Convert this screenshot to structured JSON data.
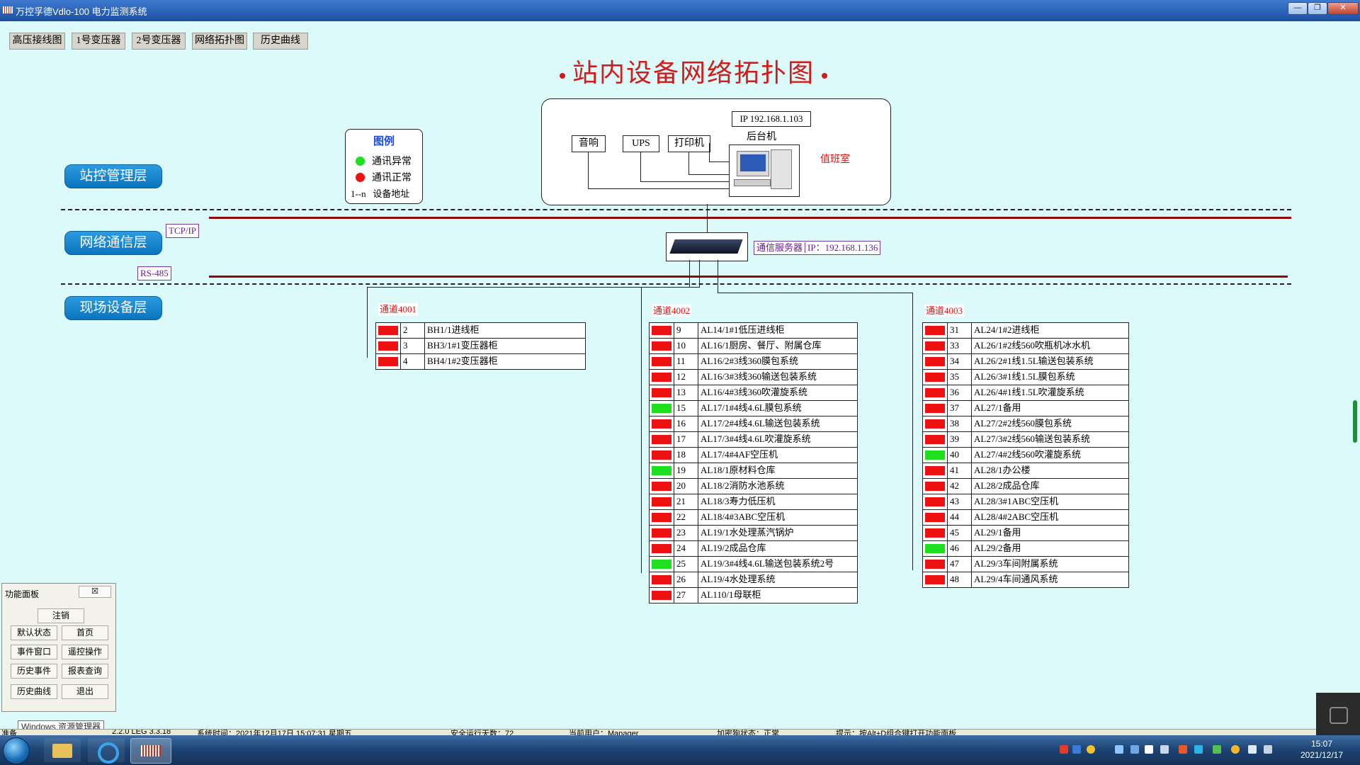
{
  "window": {
    "title": "万控孚德Vdlo-100 电力监测系统"
  },
  "tabs": [
    "高压接线图",
    "1号变压器",
    "2号变压器",
    "网络拓扑图",
    "历史曲线"
  ],
  "page_title": "站内设备网络拓扑图",
  "layers": [
    "站控管理层",
    "网络通信层",
    "现场设备层"
  ],
  "protocols": {
    "tcp": "TCP/IP",
    "rs485": "RS-485"
  },
  "legend": {
    "title": "图例",
    "items": [
      {
        "label": "通讯异常",
        "color": "#1ee01e"
      },
      {
        "label": "通讯正常",
        "color": "#ee1111"
      }
    ],
    "address_key": "1--n",
    "address_label": "设备地址"
  },
  "station": {
    "ip": "IP 192.168.1.103",
    "host": "后台机",
    "room": "值班室",
    "devices": [
      "音响",
      "UPS",
      "打印机"
    ]
  },
  "server": {
    "label": "通信服务器",
    "ip": "IP：192.168.1.136"
  },
  "colors": {
    "ok": "#1ee01e",
    "alarm": "#ee1111",
    "bus": "#8b0a0a"
  },
  "channels": [
    {
      "name": "通道4001",
      "rows": [
        {
          "status": "red",
          "addr": "2",
          "name": "BH1/1进线柜"
        },
        {
          "status": "red",
          "addr": "3",
          "name": "BH3/1#1变压器柜"
        },
        {
          "status": "red",
          "addr": "4",
          "name": "BH4/1#2变压器柜"
        }
      ]
    },
    {
      "name": "通道4002",
      "rows": [
        {
          "status": "red",
          "addr": "9",
          "name": "AL14/1#1低压进线柜"
        },
        {
          "status": "red",
          "addr": "10",
          "name": "AL16/1厨房、餐厅、附属仓库"
        },
        {
          "status": "red",
          "addr": "11",
          "name": "AL16/2#3线360膜包系统"
        },
        {
          "status": "red",
          "addr": "12",
          "name": "AL16/3#3线360输送包装系统"
        },
        {
          "status": "red",
          "addr": "13",
          "name": "AL16/4#3线360吹灌旋系统"
        },
        {
          "status": "green",
          "addr": "15",
          "name": "AL17/1#4线4.6L膜包系统"
        },
        {
          "status": "red",
          "addr": "16",
          "name": "AL17/2#4线4.6L输送包装系统"
        },
        {
          "status": "red",
          "addr": "17",
          "name": "AL17/3#4线4.6L吹灌旋系统"
        },
        {
          "status": "red",
          "addr": "18",
          "name": "AL17/4#4AF空压机"
        },
        {
          "status": "green",
          "addr": "19",
          "name": "AL18/1原材料仓库"
        },
        {
          "status": "red",
          "addr": "20",
          "name": "AL18/2消防水池系统"
        },
        {
          "status": "red",
          "addr": "21",
          "name": "AL18/3寿力低压机"
        },
        {
          "status": "red",
          "addr": "22",
          "name": "AL18/4#3ABC空压机"
        },
        {
          "status": "red",
          "addr": "23",
          "name": "AL19/1水处理蒸汽锅炉"
        },
        {
          "status": "red",
          "addr": "24",
          "name": "AL19/2成品仓库"
        },
        {
          "status": "green",
          "addr": "25",
          "name": "AL19/3#4线4.6L输送包装系统2号"
        },
        {
          "status": "red",
          "addr": "26",
          "name": "AL19/4水处理系统"
        },
        {
          "status": "red",
          "addr": "27",
          "name": "AL110/1母联柜"
        }
      ]
    },
    {
      "name": "通道4003",
      "rows": [
        {
          "status": "red",
          "addr": "31",
          "name": "AL24/1#2进线柜"
        },
        {
          "status": "red",
          "addr": "33",
          "name": "AL26/1#2线560吹瓶机冰水机"
        },
        {
          "status": "red",
          "addr": "34",
          "name": "AL26/2#1线1.5L输送包装系统"
        },
        {
          "status": "red",
          "addr": "35",
          "name": "AL26/3#1线1.5L膜包系统"
        },
        {
          "status": "red",
          "addr": "36",
          "name": "AL26/4#1线1.5L吹灌旋系统"
        },
        {
          "status": "red",
          "addr": "37",
          "name": "AL27/1备用"
        },
        {
          "status": "red",
          "addr": "38",
          "name": "AL27/2#2线560膜包系统"
        },
        {
          "status": "red",
          "addr": "39",
          "name": "AL27/3#2线560输送包装系统"
        },
        {
          "status": "green",
          "addr": "40",
          "name": "AL27/4#2线560吹灌旋系统"
        },
        {
          "status": "red",
          "addr": "41",
          "name": "AL28/1办公楼"
        },
        {
          "status": "red",
          "addr": "42",
          "name": "AL28/2成品仓库"
        },
        {
          "status": "red",
          "addr": "43",
          "name": "AL28/3#1ABC空压机"
        },
        {
          "status": "red",
          "addr": "44",
          "name": "AL28/4#2ABC空压机"
        },
        {
          "status": "red",
          "addr": "45",
          "name": "AL29/1备用"
        },
        {
          "status": "green",
          "addr": "46",
          "name": "AL29/2备用"
        },
        {
          "status": "red",
          "addr": "47",
          "name": "AL29/3车间附属系统"
        },
        {
          "status": "red",
          "addr": "48",
          "name": "AL29/4车间通风系统"
        }
      ]
    }
  ],
  "function_panel": {
    "title": "功能面板",
    "close": "☒",
    "buttons": [
      "注销",
      "默认状态",
      "首页",
      "事件窗口",
      "遥控操作",
      "历史事件",
      "报表查询",
      "历史曲线",
      "退出"
    ]
  },
  "explorer_tooltip": "Windows 资源管理器",
  "status_bar": {
    "ready": "准备",
    "version": "2.2.0 LEG 3.3.18",
    "time": "系统时间：2021年12月17日  15:07:31  星期五",
    "safe_days": "安全运行天数：72",
    "user": "当前用户：Manager",
    "encrypt": "加密狗状态：正常",
    "hint": "提示：按Alt+D组合键打开功能面板"
  },
  "clock": {
    "time": "15:07",
    "date": "2021/12/17"
  }
}
